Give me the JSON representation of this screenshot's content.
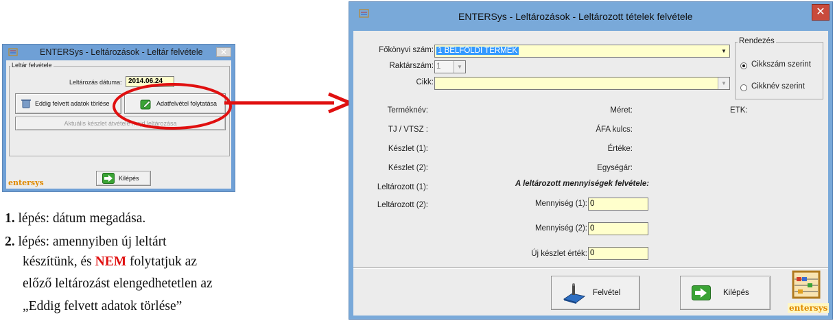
{
  "small_window": {
    "title": "ENTERSys  - Leltározások - Leltár felvétele",
    "close_glyph": "✕",
    "group_label": "Leltár felvétele",
    "date_label": "Leltározás dátuma:",
    "date_value": "2014.06.24",
    "delete_button": "Eddig felvett adatok törlése",
    "continue_button": "Adatfelvétel folytatása",
    "stock_button": "Aktuális készlet átvétele majd leltározása",
    "exit_button": "Kilépés",
    "brand": "entersys"
  },
  "big_window": {
    "title": "ENTERSys - Leltározások - Leltározott tételek felvétele",
    "close_glyph": "✕",
    "fokonyvi_label": "Főkönyvi szám:",
    "fokonyvi_value": "1  BELFÖLDI TERMÉK",
    "raktar_label": "Raktárszám:",
    "raktar_value": "1",
    "cikk_label": "Cikk:",
    "cikk_value": "",
    "sort_group_label": "Rendezés",
    "sort_options": [
      "Cikkszám szerint",
      "Cikknév szerint"
    ],
    "info_left": [
      "Terméknév:",
      "TJ / VTSZ :",
      "Készlet (1):",
      "Készlet (2):",
      "Leltározott (1):",
      "Leltározott (2):"
    ],
    "info_mid": [
      "Méret:",
      "ÁFA kulcs:",
      "Értéke:",
      "Egységár:"
    ],
    "etk_label": "ETK:",
    "entry_heading": "A leltározott mennyiségek felvétele:",
    "qty1_label": "Mennyiség (1):",
    "qty1_value": "0",
    "qty2_label": "Mennyiség (2):",
    "qty2_value": "0",
    "new_value_label": "Új készlet érték:",
    "new_value_value": "0",
    "save_button": "Felvétel",
    "exit_button": "Kilépés",
    "brand": "entersys"
  },
  "instructions": {
    "step1_num": "1.",
    "step1_text": "lépés: dátum megadása.",
    "step2_num": "2.",
    "step2_line1": "lépés: amennyiben új leltárt",
    "step2_line2_pre": "készítünk, és ",
    "step2_line2_em": "NEM",
    "step2_line2_post": " folytatjuk az",
    "step2_line3": "előző leltározást elengedhetetlen az",
    "step2_line4": "„Eddig felvett adatok törlése”"
  },
  "colors": {
    "title_bar": "#79a9d9",
    "field_yellow": "#ffffcc",
    "selection": "#3399ff",
    "annotation_red": "#e01010",
    "brand_orange": "#e08a00"
  }
}
